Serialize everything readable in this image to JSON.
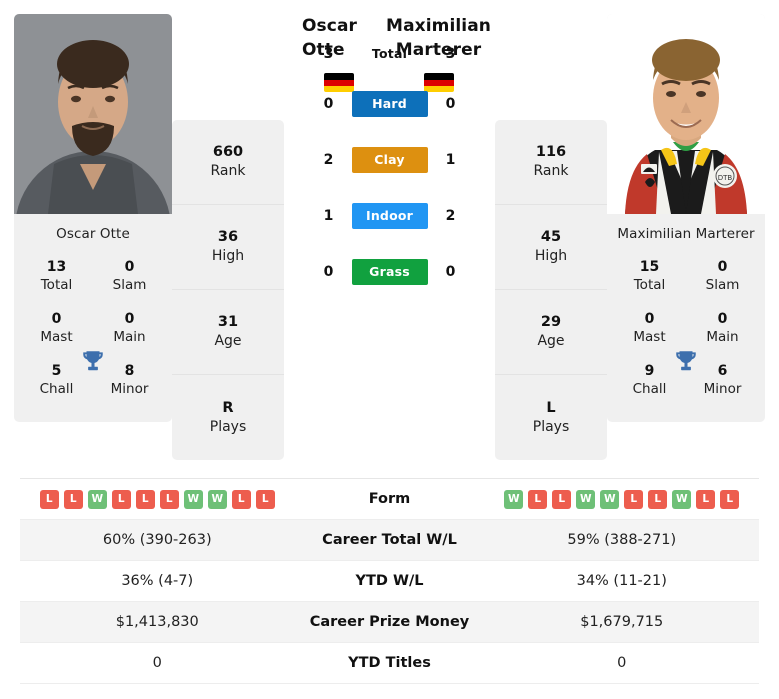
{
  "players": {
    "left": {
      "name": "Oscar Otte",
      "name_line1": "Oscar Otte",
      "country": "Germany",
      "flag": "de-flag-icon",
      "titles": {
        "total": "13",
        "total_label": "Total",
        "slam": "0",
        "slam_label": "Slam",
        "mast": "0",
        "mast_label": "Mast",
        "main": "0",
        "main_label": "Main",
        "chall": "5",
        "chall_label": "Chall",
        "minor": "8",
        "minor_label": "Minor"
      },
      "stats": [
        {
          "value": "660",
          "label": "Rank"
        },
        {
          "value": "36",
          "label": "High"
        },
        {
          "value": "31",
          "label": "Age"
        },
        {
          "value": "R",
          "label": "Plays"
        }
      ],
      "form": [
        "L",
        "L",
        "W",
        "L",
        "L",
        "L",
        "W",
        "W",
        "L",
        "L"
      ],
      "career_total_wl": "60% (390-263)",
      "ytd_wl": "36% (4-7)",
      "career_prize_money": "$1,413,830",
      "ytd_titles": "0"
    },
    "right": {
      "name": "Maximilian Marterer",
      "name_line1": "Maximilian",
      "name_line2": "Marterer",
      "country": "Germany",
      "flag": "de-flag-icon",
      "titles": {
        "total": "15",
        "total_label": "Total",
        "slam": "0",
        "slam_label": "Slam",
        "mast": "0",
        "mast_label": "Mast",
        "main": "0",
        "main_label": "Main",
        "chall": "9",
        "chall_label": "Chall",
        "minor": "6",
        "minor_label": "Minor"
      },
      "stats": [
        {
          "value": "116",
          "label": "Rank"
        },
        {
          "value": "45",
          "label": "High"
        },
        {
          "value": "29",
          "label": "Age"
        },
        {
          "value": "L",
          "label": "Plays"
        }
      ],
      "form": [
        "W",
        "L",
        "L",
        "W",
        "W",
        "L",
        "L",
        "W",
        "L",
        "L"
      ],
      "career_total_wl": "59% (388-271)",
      "ytd_wl": "34% (11-21)",
      "career_prize_money": "$1,679,715",
      "ytd_titles": "0"
    }
  },
  "head_to_head": [
    {
      "label": "Total",
      "left": "3",
      "right": "3",
      "color": "none",
      "style": "plain"
    },
    {
      "label": "Hard",
      "left": "0",
      "right": "0",
      "color": "#0d70ba",
      "style": "badge"
    },
    {
      "label": "Clay",
      "left": "2",
      "right": "1",
      "color": "#dd9010",
      "style": "badge"
    },
    {
      "label": "Indoor",
      "left": "1",
      "right": "2",
      "color": "#2196f3",
      "style": "badge"
    },
    {
      "label": "Grass",
      "left": "0",
      "right": "0",
      "color": "#11a13f",
      "style": "badge"
    }
  ],
  "table_rows": [
    {
      "label": "Form",
      "key": "form",
      "type": "form"
    },
    {
      "label": "Career Total W/L",
      "key": "career_total_wl",
      "type": "text"
    },
    {
      "label": "YTD W/L",
      "key": "ytd_wl",
      "type": "text"
    },
    {
      "label": "Career Prize Money",
      "key": "career_prize_money",
      "type": "text"
    },
    {
      "label": "YTD Titles",
      "key": "ytd_titles",
      "type": "text"
    }
  ],
  "colors": {
    "win": "#6ec077",
    "loss": "#ed5d4e",
    "trophy": "#3d6fad",
    "card_bg": "#f0f0f0",
    "row_alt": "#f4f4f4"
  }
}
